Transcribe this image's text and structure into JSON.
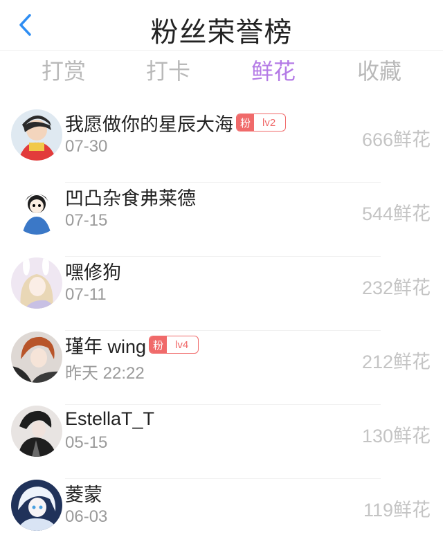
{
  "header": {
    "title": "粉丝荣誉榜"
  },
  "tabs": [
    {
      "label": "打赏"
    },
    {
      "label": "打卡"
    },
    {
      "label": "鲜花"
    },
    {
      "label": "收藏"
    }
  ],
  "active_tab": "鲜花",
  "colors": {
    "accent": "#b47ae6",
    "badge": "#f06a6a",
    "back_arrow": "#2f8ef3"
  },
  "list": [
    {
      "name": "我愿做你的星辰大海",
      "date": "07-30",
      "count": "666",
      "unit": "鲜花",
      "badge": {
        "fan": "粉",
        "level": "lv2"
      }
    },
    {
      "name": "凹凸杂食弗莱德",
      "date": "07-15",
      "count": "544",
      "unit": "鲜花"
    },
    {
      "name": "嘿修狗",
      "date": "07-11",
      "count": "232",
      "unit": "鲜花"
    },
    {
      "name": "瑾年 wing",
      "date": "昨天 22:22",
      "count": "212",
      "unit": "鲜花",
      "badge": {
        "fan": "粉",
        "level": "lv4"
      }
    },
    {
      "name": "EstellaT_T",
      "date": "05-15",
      "count": "130",
      "unit": "鲜花"
    },
    {
      "name": "菱蒙",
      "date": "06-03",
      "count": "119",
      "unit": "鲜花"
    }
  ]
}
